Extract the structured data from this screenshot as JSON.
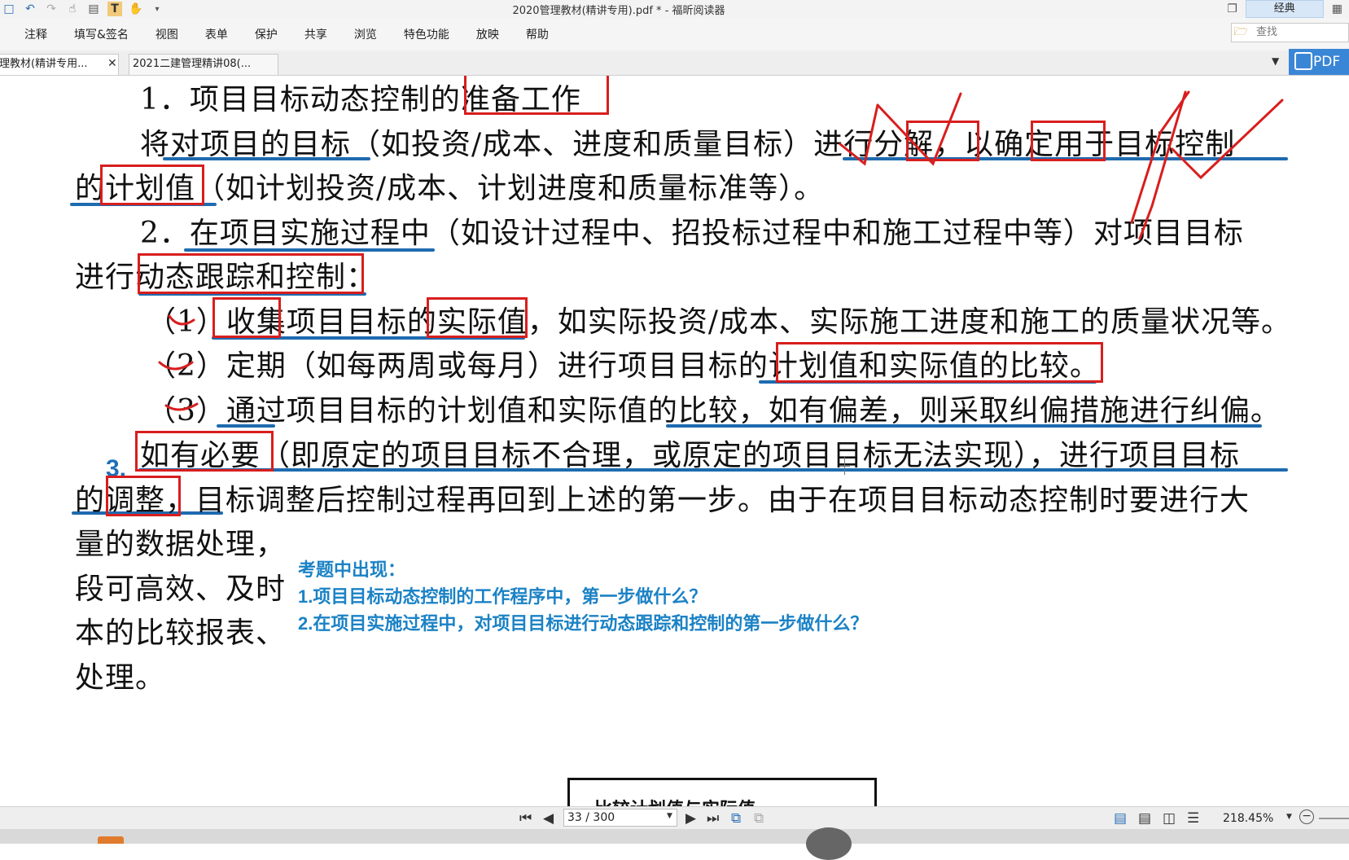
{
  "window": {
    "title": "2020管理教材(精讲专用).pdf * - 福昕阅读器",
    "mode_button": "经典"
  },
  "menu": {
    "items": [
      "注释",
      "填写&签名",
      "视图",
      "表单",
      "保护",
      "共享",
      "浏览",
      "特色功能",
      "放映",
      "帮助"
    ],
    "search_placeholder": "查找"
  },
  "tabs": [
    {
      "label": "理教材(精讲专用...",
      "active": true
    },
    {
      "label": "2021二建管理精讲08(...",
      "active": false
    }
  ],
  "pdf_button": "PDF",
  "document": {
    "line1": "1．项目目标动态控制的准备工作",
    "line2": "将对项目的目标（如投资/成本、进度和质量目标）进行分解，以确定用于目标控制",
    "line3": "的计划值（如计划投资/成本、计划进度和质量标准等）。",
    "line4": "2．在项目实施过程中（如设计过程中、招投标过程中和施工过程中等）对项目目标",
    "line5": "进行动态跟踪和控制：",
    "line6": "（1）收集项目目标的实际值，如实际投资/成本、实际施工进度和施工的质量状况等。",
    "line7": "（2）定期（如每两周或每月）进行项目目标的计划值和实际值的比较。",
    "line8": "（3）通过项目目标的计划值和实际值的比较，如有偏差，则采取纠偏措施进行纠偏。",
    "sec3_num": "3.",
    "line9": "如有必要（即原定的项目目标不合理，或原定的项目目标无法实现），进行项目目标",
    "line10": "的调整，目标调整后控制过程再回到上述的第一步。由于在项目目标动态控制时要进行大",
    "line11": "量的数据处理，",
    "line12": "段可高效、及时",
    "line13": "本的比较报表、",
    "line14": "处理。",
    "figure_caption": "比较计划值与实际值"
  },
  "note": {
    "heading": "考题中出现：",
    "q1": "1.项目目标动态控制的工作程序中，第一步做什么？",
    "q2": "2.在项目实施过程中，对项目目标进行动态跟踪和控制的第一步做什么？"
  },
  "colors": {
    "red_box": "#d81e1e",
    "blue_underline": "#1e6bb0",
    "note_text": "#1b82c5"
  },
  "statusbar": {
    "page_indicator": "33 / 300",
    "zoom": "218.45%"
  }
}
